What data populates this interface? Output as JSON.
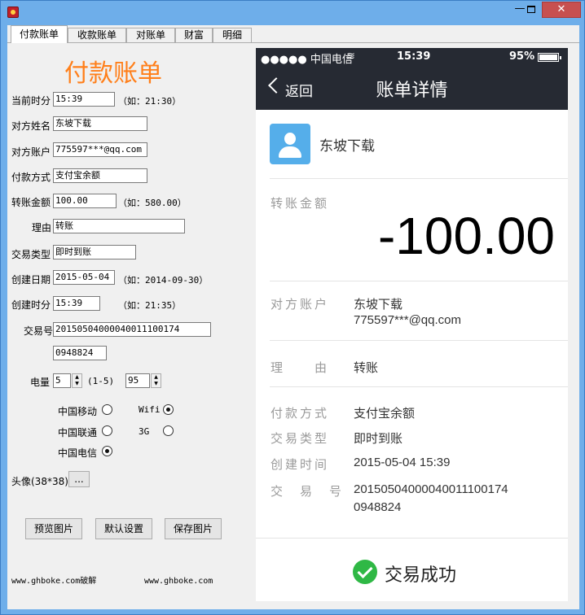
{
  "window": {
    "controls": {
      "minimize": "—",
      "close": "✕"
    }
  },
  "tabs": [
    "付款账单",
    "收款账单",
    "对账单",
    "财富",
    "明细"
  ],
  "form": {
    "title": "付款账单",
    "current_time": {
      "label": "当前时分",
      "value": "15:39",
      "hint": "（如：21:30）"
    },
    "payee_name": {
      "label": "对方姓名",
      "value": "东坡下载"
    },
    "payee_account": {
      "label": "对方账户",
      "value": "775597***@qq.com"
    },
    "pay_method": {
      "label": "付款方式",
      "value": "支付宝余额"
    },
    "amount": {
      "label": "转账金额",
      "value": "100.00",
      "hint": "（如：580.00）"
    },
    "reason": {
      "label": "理由",
      "value": "转账"
    },
    "trade_type": {
      "label": "交易类型",
      "value": "即时到账"
    },
    "create_date": {
      "label": "创建日期",
      "value": "2015-05-04",
      "hint": "（如：2014-09-30）"
    },
    "create_time": {
      "label": "创建时分",
      "value": "15:39",
      "hint": "（如：21:35）"
    },
    "trade_no": {
      "label": "交易号",
      "value1": "2015050400004001110017​4",
      "value2": "0948824"
    },
    "battery": {
      "label": "电量",
      "value1": "5",
      "range": "(1-5)",
      "value2": "95"
    },
    "carriers": {
      "mobile": "中国移动",
      "unicom": "中国联通",
      "telecom": "中国电信",
      "wifi": "Wifi",
      "g3": "3G"
    },
    "avatar": {
      "label": "头像(38*38)",
      "browse": "..."
    },
    "buttons": {
      "preview": "预览图片",
      "default": "默认设置",
      "save": "保存图片"
    },
    "footer": {
      "left": "www.ghboke.com破解",
      "right": "www.ghboke.com"
    }
  },
  "phone": {
    "status": {
      "signal": "●●●●● 中国电信",
      "time": "15:39",
      "battery": "95%"
    },
    "nav": {
      "back": "返回",
      "title": "账单详情"
    },
    "payee": "东坡下载",
    "amount_label": "转账金额",
    "amount": "-100.00",
    "account_label": "对方账户",
    "account_name": "东坡下载",
    "account_id": "775597***@qq.com",
    "reason_label": "理　　由",
    "reason": "转账",
    "method_label": "付款方式",
    "method": "支付宝余额",
    "type_label": "交易类型",
    "type": "即时到账",
    "ctime_label": "创建时间",
    "ctime": "2015-05-04 15:39",
    "tradeno_label": "交　易　号",
    "tradeno1": "2015050400004001110017​4",
    "tradeno2": "0948824",
    "result": "交易成功"
  },
  "colors": {
    "title_orange": "#ff7f1a",
    "phone_bar": "#262a33",
    "avatar_blue": "#55aeea",
    "success_green": "#2fb845"
  }
}
